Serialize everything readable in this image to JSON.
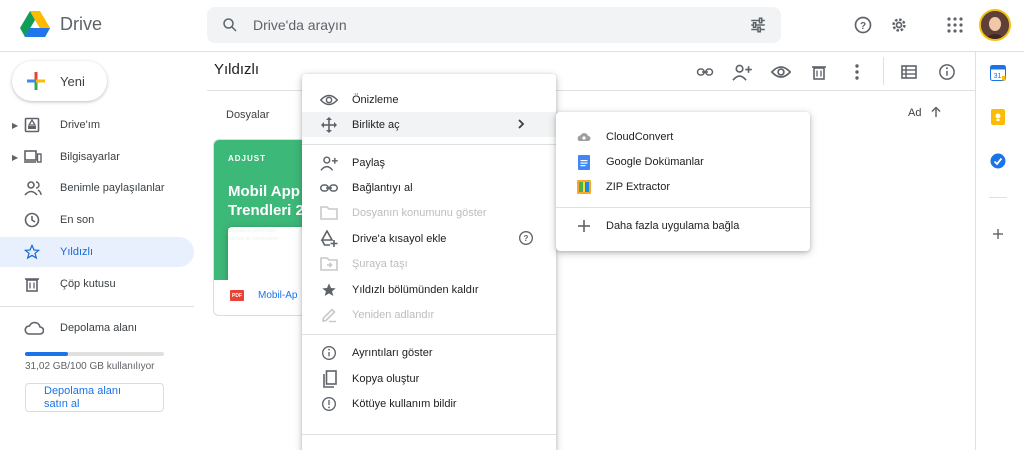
{
  "app": {
    "name": "Drive"
  },
  "search": {
    "placeholder": "Drive'da arayın"
  },
  "sidebar": {
    "new_label": "Yeni",
    "items": [
      {
        "label": "Drive'ım",
        "icon": "my-drive-icon",
        "expandable": true,
        "active": false
      },
      {
        "label": "Bilgisayarlar",
        "icon": "computer-icon",
        "expandable": true,
        "active": false
      },
      {
        "label": "Benimle paylaşılanlar",
        "icon": "shared-people-icon",
        "expandable": false,
        "active": false
      },
      {
        "label": "En son",
        "icon": "clock-icon",
        "expandable": false,
        "active": false
      },
      {
        "label": "Yıldızlı",
        "icon": "star-icon",
        "expandable": false,
        "active": true
      },
      {
        "label": "Çöp kutusu",
        "icon": "trash-icon",
        "expandable": false,
        "active": false
      }
    ],
    "storage": {
      "label": "Depolama alanı",
      "used_text": "31,02 GB/100 GB kullanılıyor",
      "used_fraction": 0.31,
      "buy_label": "Depolama alanı satın al"
    }
  },
  "main": {
    "title": "Yıldızlı",
    "section_label": "Dosyalar",
    "sort_label": "Ad",
    "file": {
      "name": "Mobil-Ap",
      "type_badge": "PDF",
      "thumbnail": {
        "brand": "ADJUST",
        "headline_1": "Mobil App",
        "headline_2": "Trendleri 2",
        "sub_1": "Uygulama performanı",
        "sub_2": "küresel bir karşılaştırm"
      }
    }
  },
  "context_menu": {
    "items": [
      {
        "label": "Önizleme",
        "icon": "eye-icon",
        "disabled": false
      },
      {
        "label": "Birlikte aç",
        "icon": "open-with-icon",
        "disabled": false,
        "submenu": true
      },
      {
        "label": "Paylaş",
        "icon": "share-person-icon",
        "disabled": false
      },
      {
        "label": "Bağlantıyı al",
        "icon": "link-icon",
        "disabled": false
      },
      {
        "label": "Dosyanın konumunu göster",
        "icon": "folder-icon",
        "disabled": true
      },
      {
        "label": "Drive'a kısayol ekle",
        "icon": "add-shortcut-icon",
        "disabled": false,
        "help": true
      },
      {
        "label": "Şuraya taşı",
        "icon": "move-icon",
        "disabled": true
      },
      {
        "label": "Yıldızlı bölümünden kaldır",
        "icon": "star-filled-icon",
        "disabled": false
      },
      {
        "label": "Yeniden adlandır",
        "icon": "rename-icon",
        "disabled": true
      },
      {
        "label": "Ayrıntıları göster",
        "icon": "info-icon",
        "disabled": false
      },
      {
        "label": "Kopya oluştur",
        "icon": "copy-icon",
        "disabled": false
      },
      {
        "label": "Kötüye kullanım bildir",
        "icon": "report-icon",
        "disabled": false
      }
    ]
  },
  "submenu": {
    "items": [
      {
        "label": "CloudConvert",
        "icon": "cloudconvert-icon"
      },
      {
        "label": "Google Dokümanlar",
        "icon": "google-docs-icon"
      },
      {
        "label": "ZIP Extractor",
        "icon": "zip-extractor-icon"
      },
      {
        "label": "Daha fazla uygulama bağla",
        "icon": "plus-icon"
      }
    ]
  },
  "colors": {
    "accent": "#1a73e8",
    "active_bg": "#e8f0fe",
    "thumbnail_green": "#3cb878",
    "pdf_red": "#ea4335"
  }
}
